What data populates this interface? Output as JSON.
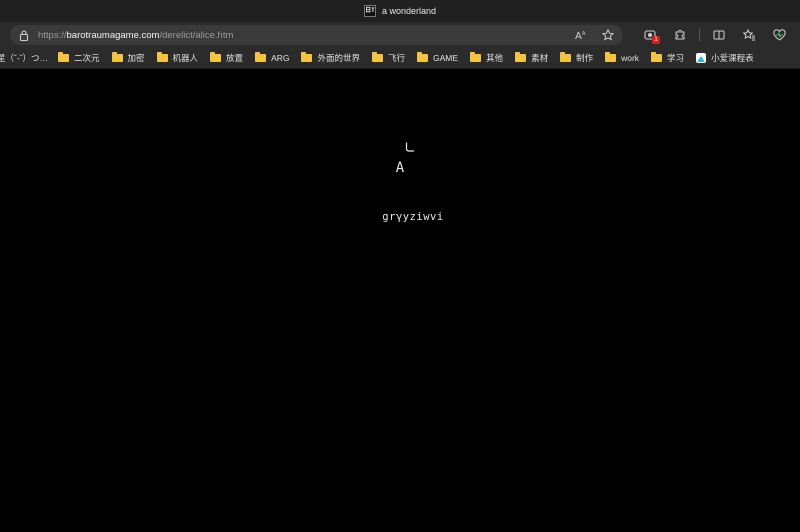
{
  "window": {
    "title": "a wonderland",
    "favicon_text": "日T"
  },
  "address_bar": {
    "protocol": "https://",
    "host": "barotraumagame.com",
    "path": "/derelict/alice.htm"
  },
  "icons": {
    "lock": "lock-icon",
    "read_aloud": "read-aloud-icon",
    "favorite": "star-icon",
    "extension_badge_count": "1"
  },
  "bookmarks": [
    {
      "label": "星（ˇ-ˇ）つ…",
      "type": "text"
    },
    {
      "label": "二次元",
      "type": "folder"
    },
    {
      "label": "加密",
      "type": "folder"
    },
    {
      "label": "机器人",
      "type": "folder"
    },
    {
      "label": "放置",
      "type": "folder"
    },
    {
      "label": "ARG",
      "type": "folder"
    },
    {
      "label": "外面的世界",
      "type": "folder"
    },
    {
      "label": "飞行",
      "type": "folder"
    },
    {
      "label": "GAME",
      "type": "folder"
    },
    {
      "label": "其他",
      "type": "folder"
    },
    {
      "label": "素材",
      "type": "folder"
    },
    {
      "label": "制作",
      "type": "folder"
    },
    {
      "label": "work",
      "type": "folder"
    },
    {
      "label": "学习",
      "type": "folder"
    },
    {
      "label": "小爱课程表",
      "type": "app"
    }
  ],
  "page": {
    "glyph": "A",
    "cipher_text": "grγyziwvi"
  },
  "colors": {
    "page_background": "#000000",
    "chrome_dark": "#202020",
    "toolbar": "#2b2b2b",
    "folder": "#f5c542",
    "badge": "#d32020"
  }
}
